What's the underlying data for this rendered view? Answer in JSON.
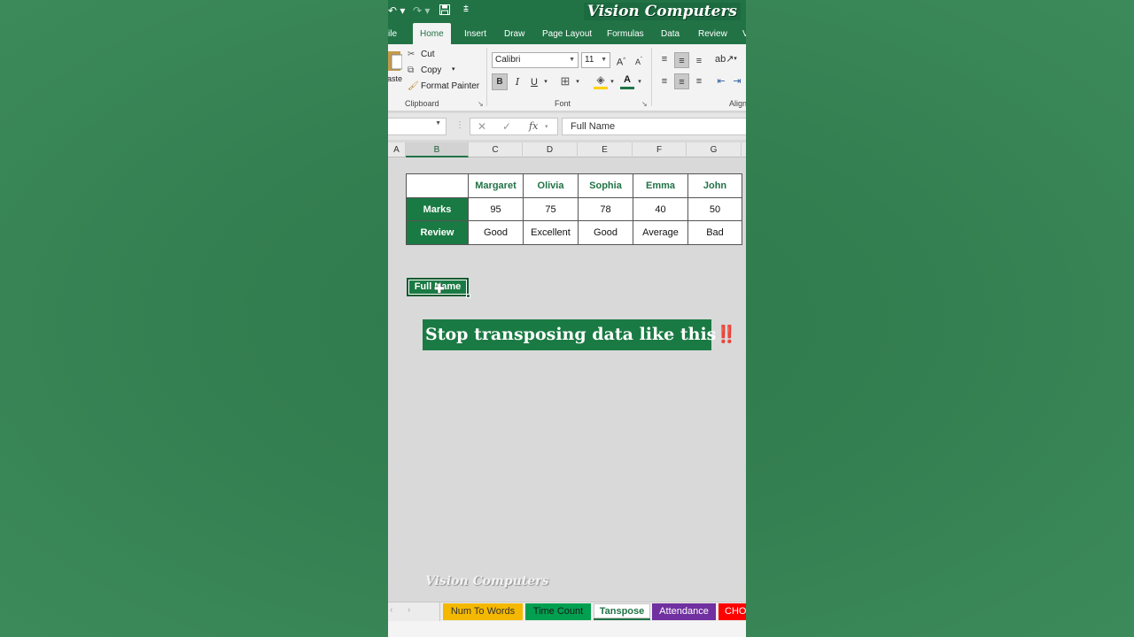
{
  "title_bar": {
    "brand": "Vision Computers",
    "undo_icon": "undo-icon",
    "redo_icon": "redo-icon",
    "save_icon": "save-icon",
    "customize_icon": "customize-qat-icon"
  },
  "ribbon_tabs": [
    "ile",
    "Home",
    "Insert",
    "Draw",
    "Page Layout",
    "Formulas",
    "Data",
    "Review",
    "V"
  ],
  "active_tab": "Home",
  "clipboard": {
    "paste_label": "aste",
    "cut": "Cut",
    "copy": "Copy",
    "format_painter": "Format Painter",
    "group_label": "Clipboard"
  },
  "font": {
    "family": "Calibri",
    "size": "11",
    "bold": "B",
    "italic": "I",
    "underline": "U",
    "font_color_glyph": "A",
    "group_label": "Font"
  },
  "alignment": {
    "group_label": "Align"
  },
  "formula_bar": {
    "cancel_glyph": "✕",
    "enter_glyph": "✓",
    "fx_glyph": "fx",
    "content": "Full Name"
  },
  "columns": [
    "A",
    "B",
    "C",
    "D",
    "E",
    "F",
    "G"
  ],
  "selected_column": "B",
  "table": {
    "names": [
      "Margaret",
      "Olivia",
      "Sophia",
      "Emma",
      "John"
    ],
    "rows": [
      {
        "label": "Marks",
        "values": [
          "95",
          "75",
          "78",
          "40",
          "50"
        ]
      },
      {
        "label": "Review",
        "values": [
          "Good",
          "Excellent",
          "Good",
          "Average",
          "Bad"
        ]
      }
    ]
  },
  "selected_cell_text": "Full Name",
  "banner": {
    "text": "Stop transposing data like this",
    "emoji": "‼️"
  },
  "watermark": "Vision Computers",
  "sheet_tabs": [
    {
      "label": "Num To Words",
      "color": "#f5b800",
      "text_color": "#333333"
    },
    {
      "label": "Time Count",
      "color": "#00a050",
      "text_color": "#1a1a1a"
    },
    {
      "label": "Tanspose",
      "color": "#ffffff",
      "text_color": "#217346",
      "active": true
    },
    {
      "label": "Attendance",
      "color": "#7030a0",
      "text_color": "#ffffff"
    },
    {
      "label": "CHO",
      "color": "#ff0000",
      "text_color": "#ffffff"
    }
  ],
  "colors": {
    "excel_green": "#217346",
    "header_fill": "#1a7a43",
    "background": "#347f51"
  }
}
